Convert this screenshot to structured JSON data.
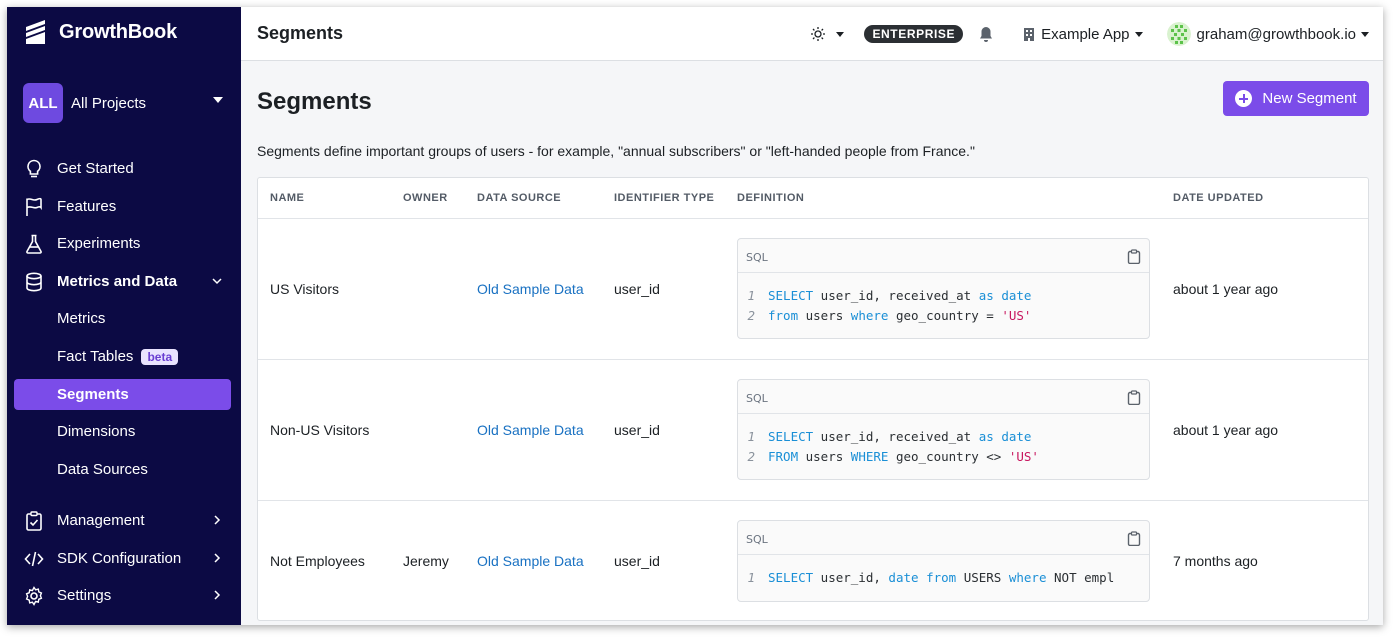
{
  "brand": {
    "name": "GrowthBook"
  },
  "project": {
    "badge": "ALL",
    "label": "All Projects"
  },
  "nav": {
    "get_started": "Get Started",
    "features": "Features",
    "experiments": "Experiments",
    "metrics_and_data": "Metrics and Data",
    "metrics": "Metrics",
    "fact_tables": "Fact Tables",
    "beta_badge": "beta",
    "segments": "Segments",
    "dimensions": "Dimensions",
    "data_sources": "Data Sources",
    "management": "Management",
    "sdk_configuration": "SDK Configuration",
    "settings": "Settings"
  },
  "topbar": {
    "title": "Segments",
    "plan_badge": "ENTERPRISE",
    "org": "Example App",
    "user": "graham@growthbook.io"
  },
  "page": {
    "title": "Segments",
    "new_button": "New Segment",
    "description": "Segments define important groups of users - for example, \"annual subscribers\" or \"left-handed people from France.\""
  },
  "table": {
    "headers": {
      "name": "NAME",
      "owner": "OWNER",
      "datasource": "DATA SOURCE",
      "identifier": "IDENTIFIER TYPE",
      "definition": "DEFINITION",
      "updated": "DATE UPDATED"
    },
    "sql_label": "SQL",
    "rows": [
      {
        "name": "US Visitors",
        "owner": "",
        "datasource": "Old Sample Data",
        "identifier": "user_id",
        "updated": "about 1 year ago",
        "sql": [
          {
            "num": "1",
            "tokens": [
              {
                "t": "SELECT",
                "k": "kw"
              },
              {
                "t": " user_id, received_at ",
                "k": "plain"
              },
              {
                "t": "as",
                "k": "kw"
              },
              {
                "t": " ",
                "k": "plain"
              },
              {
                "t": "date",
                "k": "kw"
              }
            ]
          },
          {
            "num": "2",
            "tokens": [
              {
                "t": "from",
                "k": "kw"
              },
              {
                "t": " users ",
                "k": "plain"
              },
              {
                "t": "where",
                "k": "kw"
              },
              {
                "t": " geo_country = ",
                "k": "plain"
              },
              {
                "t": "'US'",
                "k": "str"
              }
            ]
          }
        ]
      },
      {
        "name": "Non-US Visitors",
        "owner": "",
        "datasource": "Old Sample Data",
        "identifier": "user_id",
        "updated": "about 1 year ago",
        "sql": [
          {
            "num": "1",
            "tokens": [
              {
                "t": "SELECT",
                "k": "kw"
              },
              {
                "t": " user_id, received_at ",
                "k": "plain"
              },
              {
                "t": "as",
                "k": "kw"
              },
              {
                "t": " ",
                "k": "plain"
              },
              {
                "t": "date",
                "k": "kw"
              }
            ]
          },
          {
            "num": "2",
            "tokens": [
              {
                "t": "FROM",
                "k": "kw"
              },
              {
                "t": " users ",
                "k": "plain"
              },
              {
                "t": "WHERE",
                "k": "kw"
              },
              {
                "t": " geo_country <> ",
                "k": "plain"
              },
              {
                "t": "'US'",
                "k": "str"
              }
            ]
          }
        ]
      },
      {
        "name": "Not Employees",
        "owner": "Jeremy",
        "datasource": "Old Sample Data",
        "identifier": "user_id",
        "updated": "7 months ago",
        "sql": [
          {
            "num": "1",
            "tokens": [
              {
                "t": "SELECT",
                "k": "kw"
              },
              {
                "t": " user_id, ",
                "k": "plain"
              },
              {
                "t": "date",
                "k": "kw"
              },
              {
                "t": " ",
                "k": "plain"
              },
              {
                "t": "from",
                "k": "kw"
              },
              {
                "t": " USERS ",
                "k": "plain"
              },
              {
                "t": "where",
                "k": "kw"
              },
              {
                "t": " NOT empl",
                "k": "plain"
              }
            ]
          }
        ]
      }
    ]
  }
}
